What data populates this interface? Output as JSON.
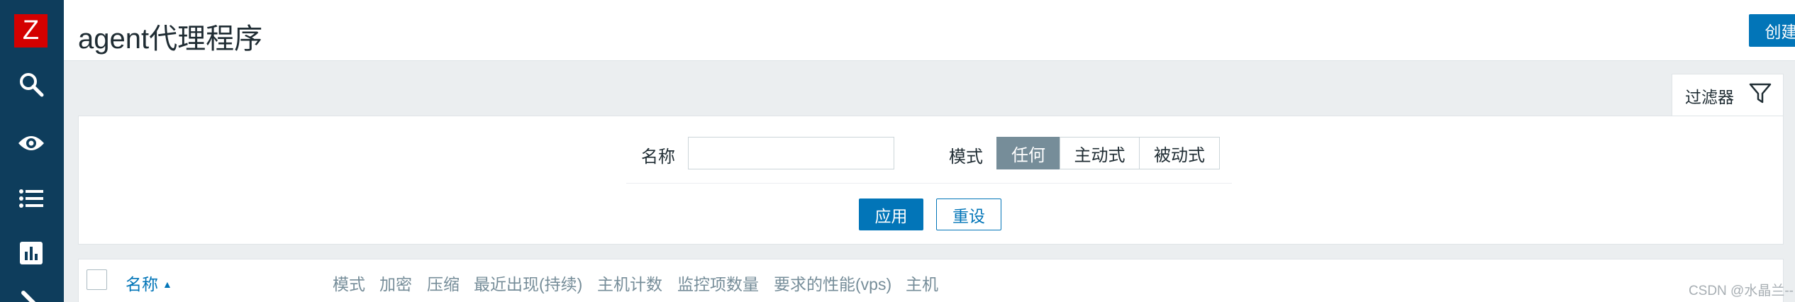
{
  "app": {
    "logo_letter": "Z",
    "brand_color": "#d40000",
    "sidebar_color": "#0e3d5c"
  },
  "sidebar": {
    "icons": [
      {
        "name": "search-icon"
      },
      {
        "name": "eye-icon"
      },
      {
        "name": "list-icon"
      },
      {
        "name": "chart-icon"
      },
      {
        "name": "wrench-icon"
      }
    ]
  },
  "header": {
    "title": "agent代理程序",
    "create_button": "创建代理"
  },
  "filter": {
    "tab_label": "过滤器",
    "name_label": "名称",
    "name_value": "",
    "mode_label": "模式",
    "mode_options": [
      "任何",
      "主动式",
      "被动式"
    ],
    "mode_selected": "任何",
    "apply_button": "应用",
    "reset_button": "重设"
  },
  "table": {
    "sort_column": "名称",
    "columns": [
      "名称",
      "模式",
      "加密",
      "压缩",
      "最近出现(持续)",
      "主机计数",
      "监控项数量",
      "要求的性能(vps)",
      "主机"
    ]
  },
  "watermark": "CSDN @水晶兰--"
}
